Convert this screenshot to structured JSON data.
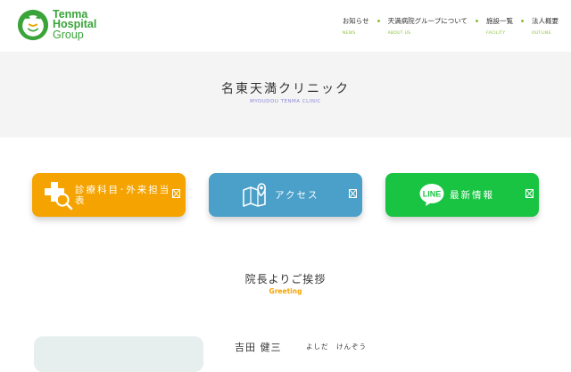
{
  "header": {
    "logo": {
      "line1": "Tenma",
      "line2": "Hospital",
      "line3": "Group"
    },
    "nav": [
      {
        "label": "お知らせ",
        "sub": "NEWS"
      },
      {
        "label": "天満病院グループについて",
        "sub": "ABOUT US"
      },
      {
        "label": "施設一覧",
        "sub": "FACILITY"
      },
      {
        "label": "法人概要",
        "sub": "OUTLINE"
      }
    ]
  },
  "hero": {
    "title": "名東天満クリニック",
    "subtitle": "MYOUDOU TENMA CLINIC"
  },
  "quicklinks": [
    {
      "label": "診療科目･外来担当表",
      "icon": "medical-cross-search-icon",
      "color": "#f5a300"
    },
    {
      "label": "アクセス",
      "icon": "map-pin-icon",
      "color": "#4aa0c8"
    },
    {
      "label": "最新情報",
      "icon": "line-app-icon",
      "icon_text": "LINE",
      "color": "#18c442"
    }
  ],
  "greeting": {
    "title": "院長よりご挨拶",
    "subtitle": "Greeting",
    "doctor_name": "吉田 健三",
    "doctor_kana": "よしだ　けんぞう"
  },
  "colors": {
    "brand_green": "#3aa43a",
    "nav_accent": "#8cbf3a",
    "orange": "#f5a300"
  }
}
